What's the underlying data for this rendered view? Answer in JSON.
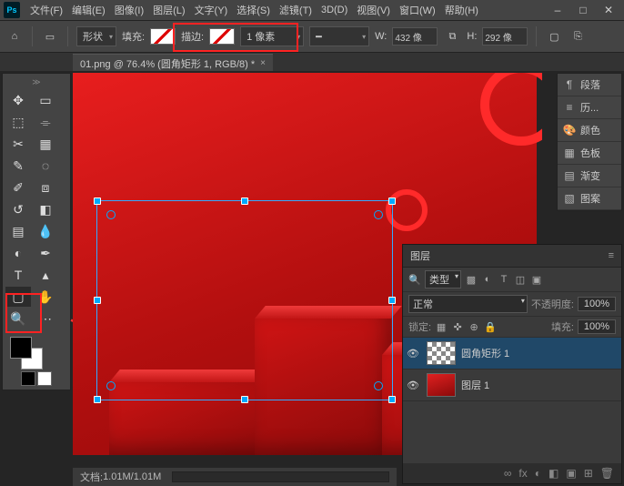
{
  "menu": {
    "items": [
      "文件(F)",
      "编辑(E)",
      "图像(I)",
      "图层(L)",
      "文字(Y)",
      "选择(S)",
      "滤镜(T)",
      "3D(D)",
      "视图(V)",
      "窗口(W)",
      "帮助(H)"
    ]
  },
  "optbar": {
    "shape_mode": "形状",
    "fill_label": "填充:",
    "stroke_label": "描边:",
    "stroke_width": "1 像素",
    "w_label": "W:",
    "w_value": "432 像",
    "h_label": "H:",
    "h_value": "292 像"
  },
  "tab": {
    "title": "01.png @ 76.4% (圆角矩形 1, RGB/8) *"
  },
  "rightpanels": {
    "items": [
      {
        "icon": "¶",
        "label": "段落"
      },
      {
        "icon": "≡",
        "label": "历..."
      },
      {
        "icon": "🎨",
        "label": "颜色"
      },
      {
        "icon": "▦",
        "label": "色板"
      },
      {
        "icon": "▤",
        "label": "渐变"
      },
      {
        "icon": "▧",
        "label": "图案"
      }
    ]
  },
  "layers": {
    "panel_title": "图层",
    "filter_label": "类型",
    "blend": "正常",
    "opacity_label": "不透明度:",
    "opacity_value": "100%",
    "lock_label": "锁定:",
    "fill_label": "填充:",
    "fill_value": "100%",
    "items": [
      {
        "name": "圆角矩形 1",
        "thumb": "chk",
        "active": true
      },
      {
        "name": "图层 1",
        "thumb": "red",
        "active": false
      }
    ],
    "footer_icons": [
      "∞",
      "fx",
      "◐",
      "◧",
      "▣",
      "⊞",
      "🗑"
    ]
  },
  "status": {
    "doc": "文档:",
    "size": "1.01M/1.01M"
  }
}
